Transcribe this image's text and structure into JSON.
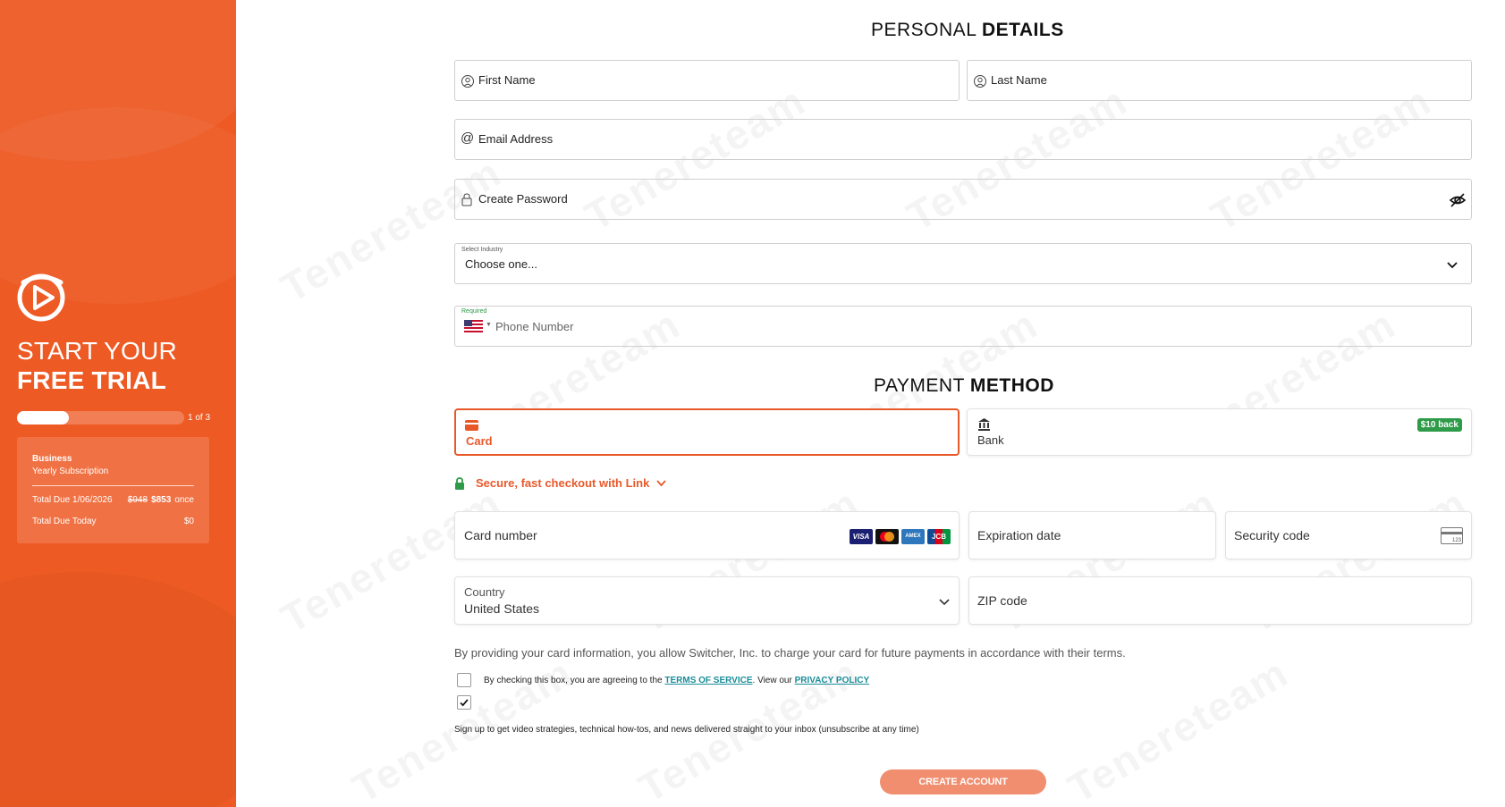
{
  "sidebar": {
    "title_light": "START YOUR",
    "title_bold": "FREE TRIAL",
    "progress_fraction": 0.31,
    "progress_label": "1 of 3",
    "summary": {
      "plan": "Business",
      "subtype": "Yearly Subscription",
      "due_label": "Total Due 1/06/2026",
      "old_price": "$948",
      "new_price": "$853",
      "cadence": "once",
      "today_label": "Total Due Today",
      "today_price": "$0"
    }
  },
  "watermark": "Tenereteam",
  "personal": {
    "title_light": "PERSONAL",
    "title_bold": "DETAILS",
    "first_name_label": "First Name",
    "last_name_label": "Last Name",
    "email_label": "Email Address",
    "password_label": "Create Password",
    "industry_caption": "Select Industry",
    "industry_value": "Choose one...",
    "phone_caption": "Required",
    "phone_label": "Phone Number"
  },
  "payment": {
    "title_light": "PAYMENT",
    "title_bold": "METHOD",
    "tab_card": "Card",
    "tab_bank": "Bank",
    "bank_badge": "$10 back",
    "secure_link": "Secure, fast checkout with Link",
    "card_number_label": "Card number",
    "expiry_label": "Expiration date",
    "cvc_label": "Security code",
    "cvc_hint": "123",
    "country_label": "Country",
    "country_value": "United States",
    "zip_label": "ZIP code",
    "card_brands": [
      "VISA",
      "mastercard",
      "AMEX",
      "JCB"
    ],
    "consent": "By providing your card information, you allow Switcher, Inc. to charge your card for future payments in accordance with their terms."
  },
  "terms": {
    "prefix": "By checking this box, you are agreeing to the",
    "tos": "TERMS OF SERVICE",
    "middle": ". View our",
    "privacy": "PRIVACY POLICY",
    "tos_checked": false,
    "signup_checked": true,
    "signup": "Sign up to get video strategies, technical how-tos, and news delivered straight to your inbox (unsubscribe at any time)"
  },
  "cta": {
    "create": "CREATE ACCOUNT"
  },
  "colors": {
    "brand": "#ee5a24",
    "link": "#1a8d99",
    "secure_green": "#2e9b48"
  }
}
